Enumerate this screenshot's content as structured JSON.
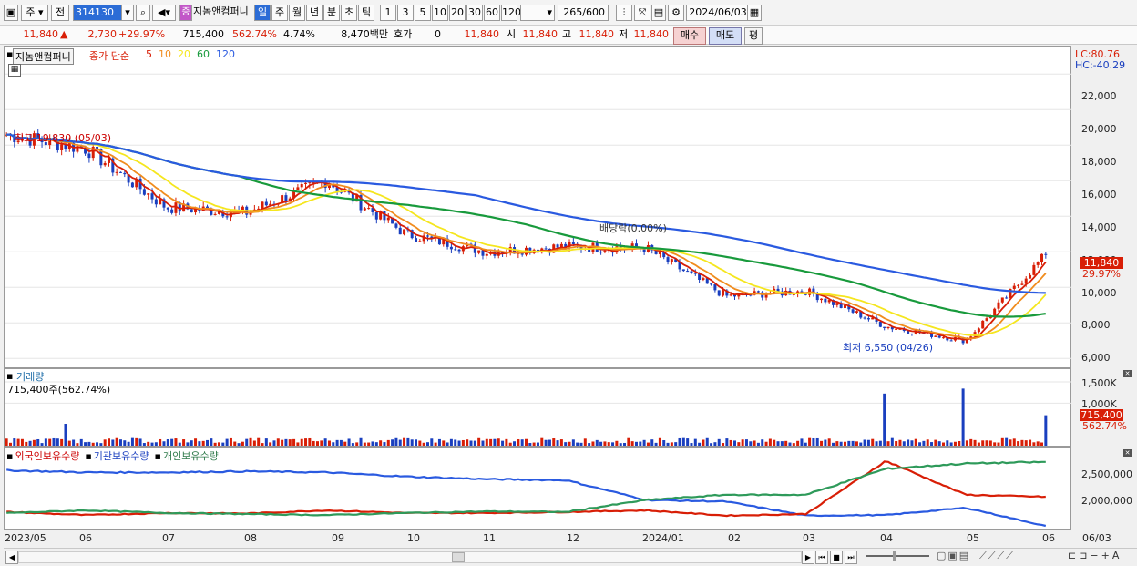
{
  "toolbar": {
    "market_label": "주",
    "prev_label": "전",
    "code_value": "314130",
    "stock_name": "지놈앤컴퍼니",
    "period_tabs": [
      "일",
      "주",
      "월",
      "년",
      "분",
      "초",
      "틱"
    ],
    "interval_tabs": [
      "1",
      "3",
      "5",
      "10",
      "20",
      "30",
      "60",
      "120"
    ],
    "count_value": "265",
    "count_total": "/600",
    "date_value": "2024/06/03"
  },
  "info": {
    "price": "11,840",
    "change": "2,730",
    "change_pct": "+29.97%",
    "volume": "715,400",
    "volume_ratio": "562.74%",
    "turnover": "4.74%",
    "trade_value": "8,470백만",
    "quote_label": "호가",
    "quote_value": "0",
    "last": "11,840",
    "open_label": "시",
    "open": "11,840",
    "high_label": "고",
    "high": "11,840",
    "low_label": "저",
    "low": "11,840",
    "buy_label": "매수",
    "sell_label": "매도",
    "eval_label": "평"
  },
  "colors": {
    "up": "#d81e06",
    "down": "#1a3fbf",
    "ma5": "#d81e06",
    "ma10": "#f08c1e",
    "ma20": "#f5e61e",
    "ma60": "#189a3c",
    "ma120": "#2a5ae0",
    "foreign": "#2a5ae0",
    "institution": "#d81e06",
    "individual": "#2e9a5a"
  },
  "price_panel": {
    "name_tag": "지놈앤컴퍼니",
    "ma_label": "종가 단순",
    "ma_periods": [
      "5",
      "10",
      "20",
      "60",
      "120"
    ],
    "lc": "LC:80.76",
    "hc": "HC:-40.29",
    "y_ticks": [
      "22,000",
      "20,000",
      "18,000",
      "16,000",
      "14,000",
      "12,000",
      "10,000",
      "8,000",
      "6,000"
    ],
    "last_price_tag": "11,840",
    "last_pct_tag": "29.97%",
    "high_note": "최고 19,830 (05/03)",
    "low_note": "최저 6,550 (04/26)",
    "dividend_note": "배당락(0.00%)"
  },
  "volume_panel": {
    "title": "거래량",
    "value_label": "715,400주(562.74%)",
    "y_ticks": [
      "1,500K",
      "1,000K"
    ],
    "last_tag": "715,400",
    "pct_tag": "562.74%"
  },
  "holding_panel": {
    "legend": [
      "외국인보유수량",
      "기관보유수량",
      "개인보유수량"
    ],
    "y_ticks": [
      "2,500,000",
      "2,000,000"
    ]
  },
  "x_axis": [
    "2023/05",
    "06",
    "07",
    "08",
    "09",
    "10",
    "11",
    "12",
    "2024/01",
    "02",
    "03",
    "04",
    "05",
    "06"
  ],
  "x_axis_right": "06/03",
  "chart_data": [
    {
      "type": "candlestick",
      "title": "지놈앤컴퍼니",
      "ylim": [
        5500,
        23500
      ],
      "series_names": [
        "5",
        "10",
        "20",
        "60",
        "120"
      ],
      "key_points": {
        "high": 19830,
        "high_date": "2023/05/03",
        "low": 6550,
        "low_date": "2024/04/26",
        "last": 11840
      },
      "approx_close_by_month": {
        "categories": [
          "2023/05",
          "06",
          "07",
          "08",
          "09",
          "10",
          "11",
          "12",
          "2024/01",
          "02",
          "03",
          "04",
          "05",
          "06"
        ],
        "values": [
          18600,
          17800,
          14500,
          14200,
          16000,
          13000,
          12000,
          12300,
          12200,
          9500,
          9800,
          7800,
          7000,
          11840
        ]
      }
    },
    {
      "type": "bar",
      "title": "거래량",
      "ylim": [
        0,
        1800000
      ],
      "last_value": 715400
    },
    {
      "type": "line",
      "series": [
        {
          "name": "외국인보유수량",
          "values": [
            2620000,
            2580000,
            2580000,
            2600000,
            2580000,
            2500000,
            2450000,
            2430000,
            2050000,
            2020000,
            1750000,
            1760000,
            1900000,
            1550000
          ]
        },
        {
          "name": "기관보유수량",
          "values": [
            1820000,
            1760000,
            1800000,
            1790000,
            1850000,
            1800000,
            1800000,
            1820000,
            1850000,
            1750000,
            1780000,
            2800000,
            2150000,
            2110000
          ]
        },
        {
          "name": "개인보유수량",
          "values": [
            1800000,
            1850000,
            1800000,
            1780000,
            1760000,
            1800000,
            1830000,
            1820000,
            2050000,
            2150000,
            2150000,
            2650000,
            2750000,
            2780000
          ]
        }
      ],
      "ylim": [
        1500000,
        2900000
      ]
    }
  ]
}
